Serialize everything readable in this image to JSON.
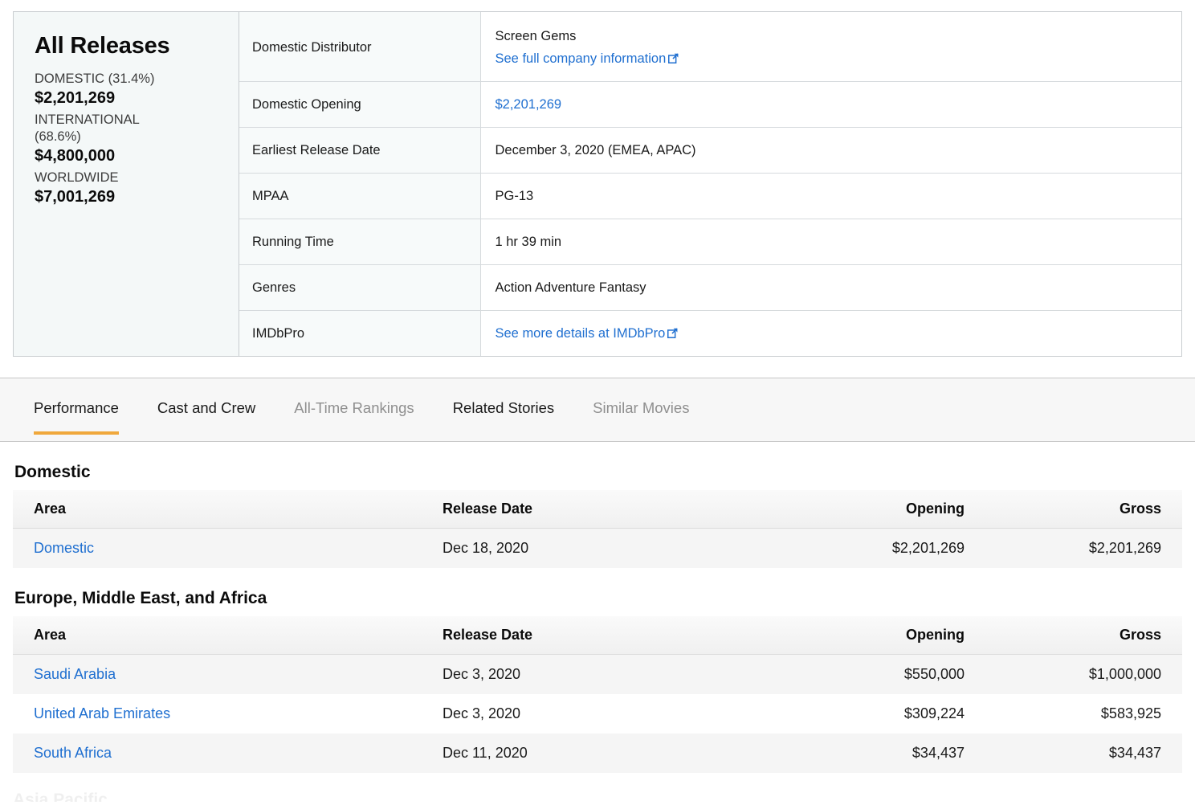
{
  "summary": {
    "title": "All Releases",
    "rows": [
      {
        "label": "DOMESTIC (31.4%)",
        "value": "$2,201,269"
      },
      {
        "label": "INTERNATIONAL (68.6%)",
        "value": "$4,800,000"
      },
      {
        "label": "WORLDWIDE",
        "value": "$7,001,269"
      }
    ]
  },
  "info": {
    "rows": [
      {
        "label": "Domestic Distributor",
        "value": "Screen Gems",
        "link_text": "See full company information",
        "link_external": true
      },
      {
        "label": "Domestic Opening",
        "value": "$2,201,269",
        "value_is_link": true
      },
      {
        "label": "Earliest Release Date",
        "value": "December 3, 2020 (EMEA, APAC)"
      },
      {
        "label": "MPAA",
        "value": "PG-13"
      },
      {
        "label": "Running Time",
        "value": "1 hr 39 min"
      },
      {
        "label": "Genres",
        "value": "Action Adventure Fantasy"
      },
      {
        "label": "IMDbPro",
        "link_text": "See more details at IMDbPro",
        "link_external": true
      }
    ]
  },
  "tabs": [
    {
      "label": "Performance",
      "active": true,
      "muted": false
    },
    {
      "label": "Cast and Crew",
      "active": false,
      "muted": false
    },
    {
      "label": "All-Time Rankings",
      "active": false,
      "muted": true
    },
    {
      "label": "Related Stories",
      "active": false,
      "muted": false
    },
    {
      "label": "Similar Movies",
      "active": false,
      "muted": true
    }
  ],
  "columns": [
    "Area",
    "Release Date",
    "Opening",
    "Gross"
  ],
  "sections": [
    {
      "title": "Domestic",
      "rows": [
        {
          "area": "Domestic",
          "release_date": "Dec 18, 2020",
          "opening": "$2,201,269",
          "gross": "$2,201,269"
        }
      ]
    },
    {
      "title": "Europe, Middle East, and Africa",
      "rows": [
        {
          "area": "Saudi Arabia",
          "release_date": "Dec 3, 2020",
          "opening": "$550,000",
          "gross": "$1,000,000"
        },
        {
          "area": "United Arab Emirates",
          "release_date": "Dec 3, 2020",
          "opening": "$309,224",
          "gross": "$583,925"
        },
        {
          "area": "South Africa",
          "release_date": "Dec 11, 2020",
          "opening": "$34,437",
          "gross": "$34,437"
        }
      ]
    }
  ],
  "clipped_next_section": "Asia Pacific",
  "colors": {
    "link": "#1f6fd0",
    "active_tab_underline": "#f0a83c",
    "summary_panel_bg": "#f4f8f8",
    "row_stripe": "#f5f5f5"
  }
}
